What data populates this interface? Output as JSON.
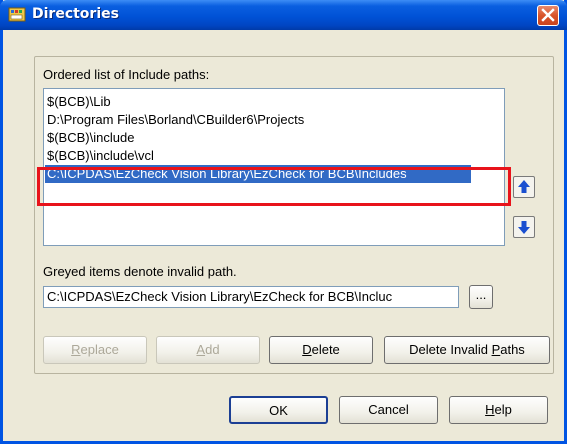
{
  "window": {
    "title": "Directories",
    "title_icon": "cbuilder-app-icon",
    "accent": "#0054e3"
  },
  "group_label": "Ordered list of Include paths:",
  "include_paths": [
    {
      "label": "$(BCB)\\Lib",
      "selected": false
    },
    {
      "label": "D:\\Program Files\\Borland\\CBuilder6\\Projects",
      "selected": false
    },
    {
      "label": "$(BCB)\\include",
      "selected": false
    },
    {
      "label": "$(BCB)\\include\\vcl",
      "selected": false
    },
    {
      "label": "C:\\ICPDAS\\EzCheck Vision Library\\EzCheck for BCB\\Includes",
      "selected": true
    }
  ],
  "move_up_icon": "arrow-up-icon",
  "move_down_icon": "arrow-down-icon",
  "highlight_color": "#e8131b",
  "greyed_note": "Greyed items denote invalid path.",
  "path_input": {
    "value": "C:\\ICPDAS\\EzCheck Vision Library\\EzCheck for BCB\\Incluc"
  },
  "browse_label": "...",
  "buttons": {
    "replace": {
      "pre": "",
      "mnemonic": "R",
      "post": "eplace",
      "enabled": false
    },
    "add": {
      "pre": "",
      "mnemonic": "A",
      "post": "dd",
      "enabled": false
    },
    "delete": {
      "pre": "",
      "mnemonic": "D",
      "post": "elete",
      "enabled": true
    },
    "delete_invalid": {
      "pre": "Delete Invalid ",
      "mnemonic": "P",
      "post": "aths",
      "enabled": true
    },
    "ok": {
      "label": "OK"
    },
    "cancel": {
      "label": "Cancel"
    },
    "help": {
      "pre": "",
      "mnemonic": "H",
      "post": "elp"
    }
  }
}
